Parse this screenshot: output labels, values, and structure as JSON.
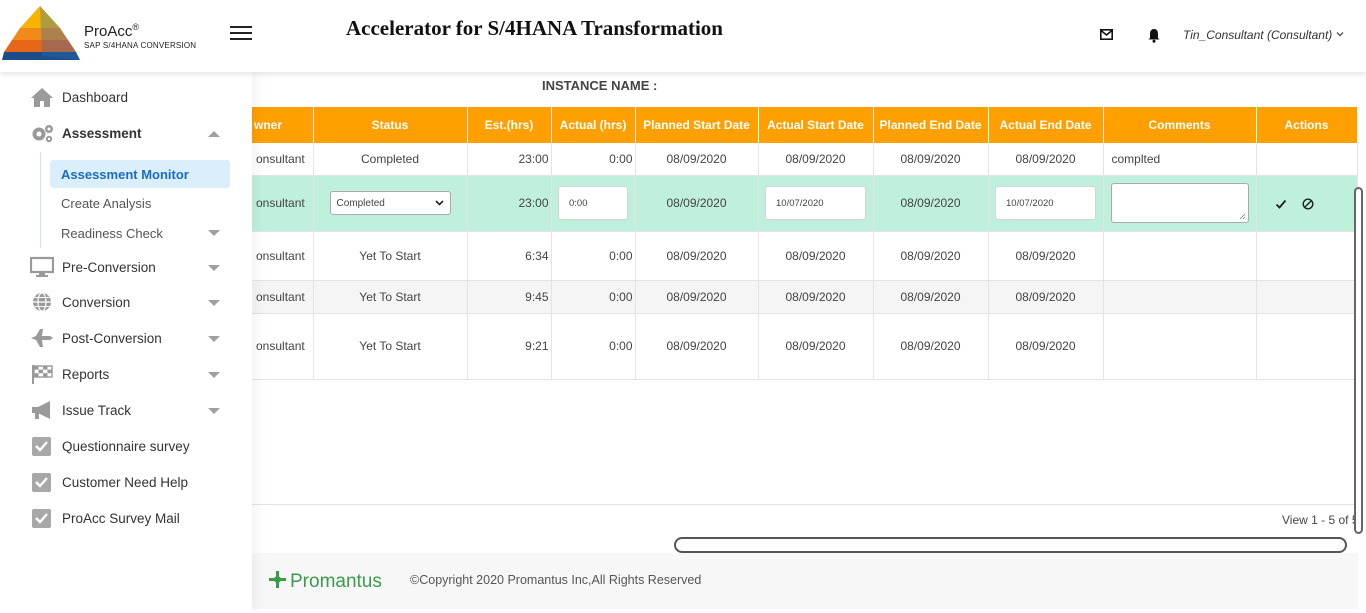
{
  "header": {
    "brand_name": "ProAcc",
    "brand_mark": "®",
    "brand_sub": "SAP S/4HANA CONVERSION",
    "app_title": "Accelerator for S/4HANA Transformation",
    "user": "Tin_Consultant (Consultant)",
    "icons": [
      "hamburger-menu-icon",
      "mail-icon",
      "bell-icon",
      "chevron-down-icon"
    ]
  },
  "sidebar": {
    "items": [
      {
        "label": "Dashboard",
        "icon": "home-icon"
      },
      {
        "label": "Assessment",
        "icon": "gears-icon",
        "expanded": true
      },
      {
        "label": "Pre-Conversion",
        "icon": "monitor-icon"
      },
      {
        "label": "Conversion",
        "icon": "globe-icon"
      },
      {
        "label": "Post-Conversion",
        "icon": "plane-icon"
      },
      {
        "label": "Reports",
        "icon": "flag-icon"
      },
      {
        "label": "Issue Track",
        "icon": "megaphone-icon"
      },
      {
        "label": "Questionnaire survey",
        "icon": "checkbox-icon"
      },
      {
        "label": "Customer Need Help",
        "icon": "checkbox-icon"
      },
      {
        "label": "ProAcc Survey Mail",
        "icon": "checkbox-icon"
      }
    ],
    "sub_items": [
      {
        "label": "Assessment Monitor",
        "active": true
      },
      {
        "label": "Create Analysis"
      },
      {
        "label": "Readiness Check"
      }
    ]
  },
  "main": {
    "instance_label": "INSTANCE NAME :",
    "columns": [
      "wner",
      "Status",
      "Est.(hrs)",
      "Actual (hrs)",
      "Planned Start Date",
      "Actual Start Date",
      "Planned End Date",
      "Actual End Date",
      "Comments",
      "Actions"
    ],
    "rows": [
      {
        "owner": "onsultant",
        "status": "Completed",
        "est": "23:00",
        "actual": "0:00",
        "planned_start": "08/09/2020",
        "actual_start": "08/09/2020",
        "planned_end": "08/09/2020",
        "actual_end": "08/09/2020",
        "comments": "complted"
      },
      {
        "owner": "onsultant",
        "status": "Completed",
        "est": "23:00",
        "actual": "0:00",
        "planned_start": "08/09/2020",
        "actual_start": "10/07/2020",
        "planned_end": "08/09/2020",
        "actual_end": "10/07/2020",
        "comments": "",
        "editing": true
      },
      {
        "owner": "onsultant",
        "status": "Yet To Start",
        "est": "6:34",
        "actual": "0:00",
        "planned_start": "08/09/2020",
        "actual_start": "08/09/2020",
        "planned_end": "08/09/2020",
        "actual_end": "08/09/2020",
        "comments": ""
      },
      {
        "owner": "onsultant",
        "status": "Yet To Start",
        "est": "9:45",
        "actual": "0:00",
        "planned_start": "08/09/2020",
        "actual_start": "08/09/2020",
        "planned_end": "08/09/2020",
        "actual_end": "08/09/2020",
        "comments": ""
      },
      {
        "owner": "onsultant",
        "status": "Yet To Start",
        "est": "9:21",
        "actual": "0:00",
        "planned_start": "08/09/2020",
        "actual_start": "08/09/2020",
        "planned_end": "08/09/2020",
        "actual_end": "08/09/2020",
        "comments": ""
      }
    ],
    "pager": "View 1 - 5 of 5"
  },
  "footer": {
    "logo_text": "Promantus",
    "copyright": "©Copyright 2020 Promantus Inc,All Rights Reserved"
  },
  "colors": {
    "header_bg": "#ff9f00",
    "edit_row": "#bff0dc",
    "active_bg": "#daeefc",
    "active_text": "#1a6dc2",
    "promantus_green": "#3a9b4a"
  }
}
